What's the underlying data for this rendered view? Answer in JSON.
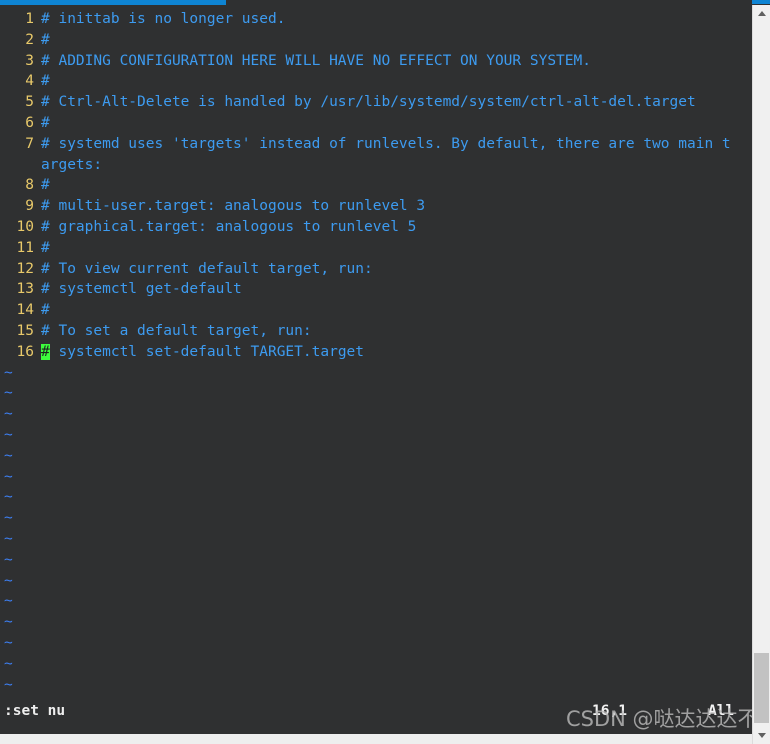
{
  "window": {
    "title_bar_color": "#0e84d3",
    "terminal_bg": "#2f3031"
  },
  "editor": {
    "name": "vim",
    "colors": {
      "line_number": "#e8c96a",
      "comment_text": "#3d9bf0",
      "tilde": "#3d7ef0",
      "cursor_bg": "#3dfb3d",
      "cursor_fg": "#1d1f20",
      "status_text": "#f2f2f2"
    },
    "lines": [
      {
        "num": "1",
        "text": "# inittab is no longer used."
      },
      {
        "num": "2",
        "text": "#"
      },
      {
        "num": "3",
        "text": "# ADDING CONFIGURATION HERE WILL HAVE NO EFFECT ON YOUR SYSTEM."
      },
      {
        "num": "4",
        "text": "#"
      },
      {
        "num": "5",
        "text": "# Ctrl-Alt-Delete is handled by /usr/lib/systemd/system/ctrl-alt-del.target"
      },
      {
        "num": "6",
        "text": "#"
      },
      {
        "num": "7",
        "text": "# systemd uses 'targets' instead of runlevels. By default, there are two main t"
      },
      {
        "num": "",
        "text": "argets:"
      },
      {
        "num": "8",
        "text": "#"
      },
      {
        "num": "9",
        "text": "# multi-user.target: analogous to runlevel 3"
      },
      {
        "num": "10",
        "text": "# graphical.target: analogous to runlevel 5"
      },
      {
        "num": "11",
        "text": "#"
      },
      {
        "num": "12",
        "text": "# To view current default target, run:"
      },
      {
        "num": "13",
        "text": "# systemctl get-default"
      },
      {
        "num": "14",
        "text": "#"
      },
      {
        "num": "15",
        "text": "# To set a default target, run:"
      }
    ],
    "cursor_line": {
      "num": "16",
      "cursor_char": "#",
      "rest": " systemctl set-default TARGET.target"
    },
    "tilde_count": 16,
    "tilde_char": "~"
  },
  "status": {
    "command": ":set nu",
    "ruler": "16,1",
    "file_position": "All"
  },
  "watermark": {
    "text": "CSDN @哒达达达不溜"
  },
  "scrollbar": {
    "up_arrow": "scroll-up-arrow",
    "down_arrow": "scroll-down-arrow"
  }
}
